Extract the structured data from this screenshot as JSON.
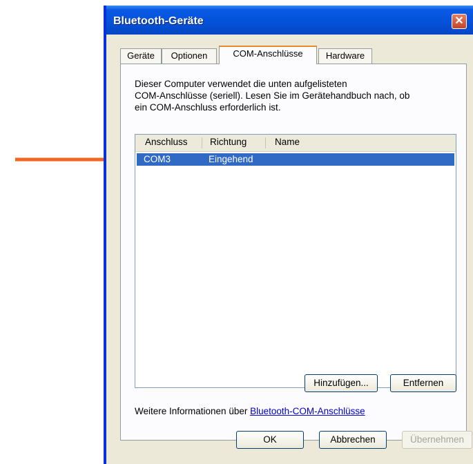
{
  "window": {
    "title": "Bluetooth-Geräte",
    "close_symbol": "✕"
  },
  "tabs": [
    {
      "label": "Geräte",
      "active": false
    },
    {
      "label": "Optionen",
      "active": false
    },
    {
      "label": "COM-Anschlüsse",
      "active": true
    },
    {
      "label": "Hardware",
      "active": false
    }
  ],
  "description": [
    "Dieser Computer verwendet die unten aufgelisteten",
    "COM-Anschlüsse (seriell). Lesen Sie im Gerätehandbuch nach, ob",
    "ein COM-Anschluss erforderlich ist."
  ],
  "ports_table": {
    "columns": [
      "Anschluss",
      "Richtung",
      "Name"
    ],
    "rows": [
      {
        "port": "COM3",
        "direction": "Eingehend",
        "name": "",
        "selected": true
      }
    ]
  },
  "buttons": {
    "add": "Hinzufügen...",
    "remove": "Entfernen",
    "ok": "OK",
    "cancel": "Abbrechen",
    "apply": "Übernehmen"
  },
  "more_info": {
    "prefix": "Weitere Informationen über ",
    "link": "Bluetooth-COM-Anschlüsse"
  },
  "colors": {
    "title_bar": "#0552d9",
    "selection": "#316ac5",
    "arrow": "#f26522",
    "dialog_bg": "#ece9d8"
  }
}
